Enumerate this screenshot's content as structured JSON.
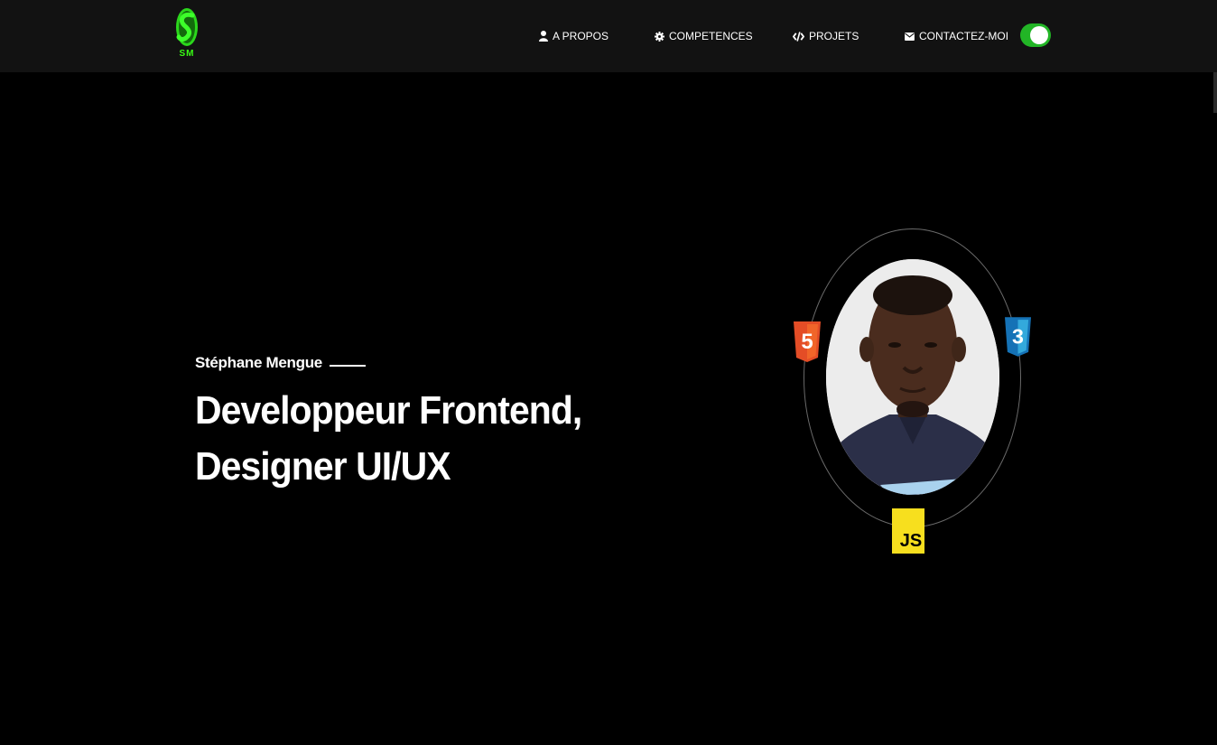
{
  "navbar": {
    "logo_text": "SM",
    "items": [
      {
        "label": "A PROPOS",
        "icon": "user-icon"
      },
      {
        "label": "COMPETENCES",
        "icon": "gear-icon"
      },
      {
        "label": "PROJETS",
        "icon": "code-icon"
      },
      {
        "label": "CONTACTEZ-MOI",
        "icon": "envelope-icon"
      }
    ],
    "theme_toggle": {
      "on": true
    }
  },
  "hero": {
    "name": "Stéphane Mengue",
    "title_line1": "Developpeur Frontend,",
    "title_line2": "Designer UI/UX"
  },
  "badges": {
    "html": "5",
    "css": "3",
    "js": "JS"
  },
  "colors": {
    "background": "#000000",
    "navbar": "#121212",
    "accent_green": "#22b526",
    "logo_green": "#39ff14",
    "html_orange": "#e44d26",
    "css_blue": "#1572b6",
    "js_yellow": "#f7df1e"
  }
}
